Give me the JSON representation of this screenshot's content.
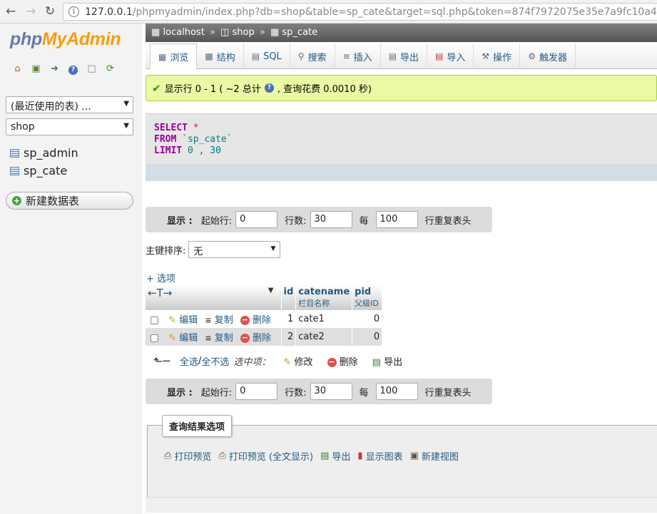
{
  "browser": {
    "url_host": "127.0.0.1",
    "url_path": "/phpmyadmin/index.php?db=shop&table=sp_cate&target=sql.php&token=874f7972075e35e7a9fc10a4bec13b"
  },
  "sidebar": {
    "logo_part1": "php",
    "logo_part2": "MyAdmin",
    "recent_select": "(最近使用的表) ...",
    "db_select": "shop",
    "tables": [
      "sp_admin",
      "sp_cate"
    ],
    "new_table": "新建数据表"
  },
  "breadcrumb": {
    "server": "localhost",
    "database": "shop",
    "table": "sp_cate"
  },
  "tabs": [
    {
      "label": "浏览",
      "icon": "browse-icon"
    },
    {
      "label": "结构",
      "icon": "structure-icon"
    },
    {
      "label": "SQL",
      "icon": "sql-icon"
    },
    {
      "label": "搜索",
      "icon": "search-icon"
    },
    {
      "label": "插入",
      "icon": "insert-icon"
    },
    {
      "label": "导出",
      "icon": "export-icon"
    },
    {
      "label": "导入",
      "icon": "import-icon"
    },
    {
      "label": "操作",
      "icon": "wrench-icon"
    },
    {
      "label": "触发器",
      "icon": "trigger-icon"
    }
  ],
  "message": {
    "part1": "显示行 0 - 1 ( ~2 总计",
    "part2": ", 查询花费 0.0010 秒)"
  },
  "sql": {
    "kw_select": "SELECT",
    "star": " *",
    "kw_from": "FROM",
    "from_table": " `sp_cate`",
    "kw_limit": "LIMIT",
    "limit_val": " 0 , 30"
  },
  "nav": {
    "show": "显示 :",
    "start_label": "起始行:",
    "start_value": "0",
    "rows_label": "行数:",
    "rows_value": "30",
    "per_label": "每",
    "per_value": "100",
    "repeat_label": "行重复表头"
  },
  "sort": {
    "label": "主键排序:",
    "value": "无"
  },
  "options_link": "+ 选项",
  "table": {
    "arrows": "←T→",
    "columns": [
      {
        "name": "id",
        "comment": ""
      },
      {
        "name": "catename",
        "comment": "栏目名称"
      },
      {
        "name": "pid",
        "comment": "父级ID"
      }
    ],
    "edit": "编辑",
    "copy": "复制",
    "delete": "删除",
    "rows": [
      {
        "id": "1",
        "catename": "cate1",
        "pid": "0"
      },
      {
        "id": "2",
        "catename": "cate2",
        "pid": "0"
      }
    ]
  },
  "bulk": {
    "check_all": "全选",
    "slash": " / ",
    "uncheck_all": "全不选",
    "with_selected": "选中项：",
    "modify": "修改",
    "delete": "删除",
    "export": "导出"
  },
  "query_results": {
    "legend": "查询结果选项",
    "print": "打印预览",
    "print_full": "打印预览 (全文显示)",
    "export": "导出",
    "chart": "显示图表",
    "create_view": "新建视图"
  }
}
